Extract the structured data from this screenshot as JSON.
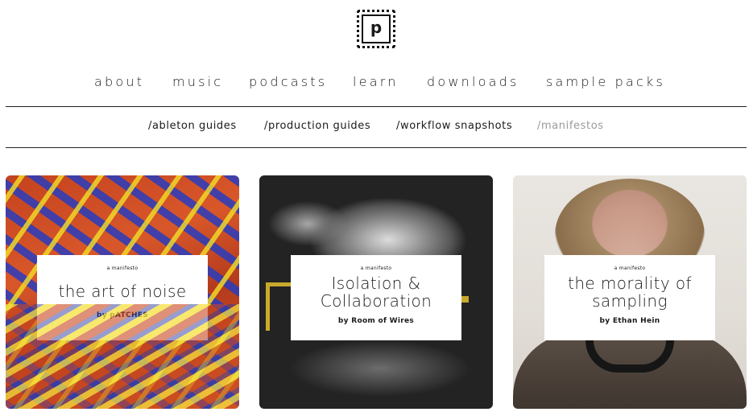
{
  "logo": {
    "letter": "p"
  },
  "main_nav": {
    "items": [
      {
        "label": "about"
      },
      {
        "label": "music"
      },
      {
        "label": "podcasts"
      },
      {
        "label": "learn"
      },
      {
        "label": "downloads"
      },
      {
        "label": "sample packs"
      }
    ]
  },
  "sub_nav": {
    "items": [
      {
        "label": "/ableton guides",
        "active": false
      },
      {
        "label": "/production guides",
        "active": false
      },
      {
        "label": "/workflow snapshots",
        "active": false
      },
      {
        "label": "/manifestos",
        "active": true
      }
    ]
  },
  "colors": {
    "text": "#1a1a1a",
    "active_subnav": "#9a9a9a",
    "rule": "#222222",
    "accent_yellow": "#c9a92b"
  },
  "cards": [
    {
      "kicker": "a manifesto",
      "title_lines": [
        "the art of noise"
      ],
      "byline": "by pATCHES",
      "image_icon": "abstract-painting-image"
    },
    {
      "kicker": "a manifesto",
      "title_lines": [
        "Isolation &",
        "Collaboration"
      ],
      "byline": "by Room of Wires",
      "image_icon": "abstract-monochrome-image"
    },
    {
      "kicker": "a manifesto",
      "title_lines": [
        "the morality of",
        "sampling"
      ],
      "byline": "by Ethan Hein",
      "image_icon": "portrait-photo-image"
    }
  ]
}
